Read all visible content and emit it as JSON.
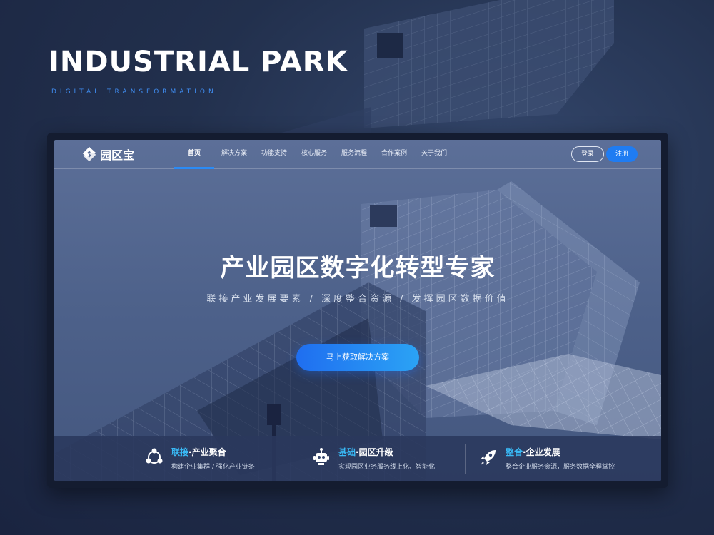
{
  "poster": {
    "title": "INDUSTRIAL PARK",
    "subtitle": "DIGITAL TRANSFORMATION"
  },
  "brand": {
    "name": "园区宝",
    "accent": "#1f7cf2",
    "highlight": "#39b9f5"
  },
  "nav": {
    "items": [
      {
        "label": "首页",
        "active": true
      },
      {
        "label": "解决方案"
      },
      {
        "label": "功能支持"
      },
      {
        "label": "核心服务"
      },
      {
        "label": "服务流程"
      },
      {
        "label": "合作案例"
      },
      {
        "label": "关于我们"
      }
    ],
    "login": "登录",
    "register": "注册"
  },
  "hero": {
    "title": "产业园区数字化转型专家",
    "subtitle": "联接产业发展要素 / 深度整合资源 / 发挥园区数据价值",
    "cta": "马上获取解决方案"
  },
  "features": [
    {
      "icon": "connect-icon",
      "highlight": "联接",
      "title": "·产业聚合",
      "desc": "构建企业集群 / 强化产业链条"
    },
    {
      "icon": "robot-icon",
      "highlight": "基础",
      "title": "·园区升级",
      "desc": "实现园区业务服务线上化、智能化"
    },
    {
      "icon": "rocket-icon",
      "highlight": "整合",
      "title": "·企业发展",
      "desc": "整合企业服务资源，服务数据全程掌控"
    }
  ]
}
